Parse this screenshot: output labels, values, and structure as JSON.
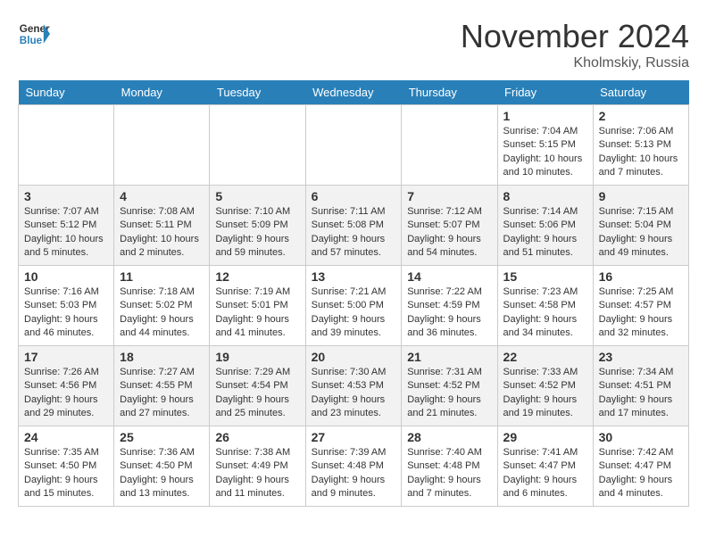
{
  "logo": {
    "line1": "General",
    "line2": "Blue"
  },
  "title": "November 2024",
  "location": "Kholmskiy, Russia",
  "weekdays": [
    "Sunday",
    "Monday",
    "Tuesday",
    "Wednesday",
    "Thursday",
    "Friday",
    "Saturday"
  ],
  "weeks": [
    [
      {
        "day": "",
        "info": ""
      },
      {
        "day": "",
        "info": ""
      },
      {
        "day": "",
        "info": ""
      },
      {
        "day": "",
        "info": ""
      },
      {
        "day": "",
        "info": ""
      },
      {
        "day": "1",
        "info": "Sunrise: 7:04 AM\nSunset: 5:15 PM\nDaylight: 10 hours\nand 10 minutes."
      },
      {
        "day": "2",
        "info": "Sunrise: 7:06 AM\nSunset: 5:13 PM\nDaylight: 10 hours\nand 7 minutes."
      }
    ],
    [
      {
        "day": "3",
        "info": "Sunrise: 7:07 AM\nSunset: 5:12 PM\nDaylight: 10 hours\nand 5 minutes."
      },
      {
        "day": "4",
        "info": "Sunrise: 7:08 AM\nSunset: 5:11 PM\nDaylight: 10 hours\nand 2 minutes."
      },
      {
        "day": "5",
        "info": "Sunrise: 7:10 AM\nSunset: 5:09 PM\nDaylight: 9 hours\nand 59 minutes."
      },
      {
        "day": "6",
        "info": "Sunrise: 7:11 AM\nSunset: 5:08 PM\nDaylight: 9 hours\nand 57 minutes."
      },
      {
        "day": "7",
        "info": "Sunrise: 7:12 AM\nSunset: 5:07 PM\nDaylight: 9 hours\nand 54 minutes."
      },
      {
        "day": "8",
        "info": "Sunrise: 7:14 AM\nSunset: 5:06 PM\nDaylight: 9 hours\nand 51 minutes."
      },
      {
        "day": "9",
        "info": "Sunrise: 7:15 AM\nSunset: 5:04 PM\nDaylight: 9 hours\nand 49 minutes."
      }
    ],
    [
      {
        "day": "10",
        "info": "Sunrise: 7:16 AM\nSunset: 5:03 PM\nDaylight: 9 hours\nand 46 minutes."
      },
      {
        "day": "11",
        "info": "Sunrise: 7:18 AM\nSunset: 5:02 PM\nDaylight: 9 hours\nand 44 minutes."
      },
      {
        "day": "12",
        "info": "Sunrise: 7:19 AM\nSunset: 5:01 PM\nDaylight: 9 hours\nand 41 minutes."
      },
      {
        "day": "13",
        "info": "Sunrise: 7:21 AM\nSunset: 5:00 PM\nDaylight: 9 hours\nand 39 minutes."
      },
      {
        "day": "14",
        "info": "Sunrise: 7:22 AM\nSunset: 4:59 PM\nDaylight: 9 hours\nand 36 minutes."
      },
      {
        "day": "15",
        "info": "Sunrise: 7:23 AM\nSunset: 4:58 PM\nDaylight: 9 hours\nand 34 minutes."
      },
      {
        "day": "16",
        "info": "Sunrise: 7:25 AM\nSunset: 4:57 PM\nDaylight: 9 hours\nand 32 minutes."
      }
    ],
    [
      {
        "day": "17",
        "info": "Sunrise: 7:26 AM\nSunset: 4:56 PM\nDaylight: 9 hours\nand 29 minutes."
      },
      {
        "day": "18",
        "info": "Sunrise: 7:27 AM\nSunset: 4:55 PM\nDaylight: 9 hours\nand 27 minutes."
      },
      {
        "day": "19",
        "info": "Sunrise: 7:29 AM\nSunset: 4:54 PM\nDaylight: 9 hours\nand 25 minutes."
      },
      {
        "day": "20",
        "info": "Sunrise: 7:30 AM\nSunset: 4:53 PM\nDaylight: 9 hours\nand 23 minutes."
      },
      {
        "day": "21",
        "info": "Sunrise: 7:31 AM\nSunset: 4:52 PM\nDaylight: 9 hours\nand 21 minutes."
      },
      {
        "day": "22",
        "info": "Sunrise: 7:33 AM\nSunset: 4:52 PM\nDaylight: 9 hours\nand 19 minutes."
      },
      {
        "day": "23",
        "info": "Sunrise: 7:34 AM\nSunset: 4:51 PM\nDaylight: 9 hours\nand 17 minutes."
      }
    ],
    [
      {
        "day": "24",
        "info": "Sunrise: 7:35 AM\nSunset: 4:50 PM\nDaylight: 9 hours\nand 15 minutes."
      },
      {
        "day": "25",
        "info": "Sunrise: 7:36 AM\nSunset: 4:50 PM\nDaylight: 9 hours\nand 13 minutes."
      },
      {
        "day": "26",
        "info": "Sunrise: 7:38 AM\nSunset: 4:49 PM\nDaylight: 9 hours\nand 11 minutes."
      },
      {
        "day": "27",
        "info": "Sunrise: 7:39 AM\nSunset: 4:48 PM\nDaylight: 9 hours\nand 9 minutes."
      },
      {
        "day": "28",
        "info": "Sunrise: 7:40 AM\nSunset: 4:48 PM\nDaylight: 9 hours\nand 7 minutes."
      },
      {
        "day": "29",
        "info": "Sunrise: 7:41 AM\nSunset: 4:47 PM\nDaylight: 9 hours\nand 6 minutes."
      },
      {
        "day": "30",
        "info": "Sunrise: 7:42 AM\nSunset: 4:47 PM\nDaylight: 9 hours\nand 4 minutes."
      }
    ]
  ]
}
